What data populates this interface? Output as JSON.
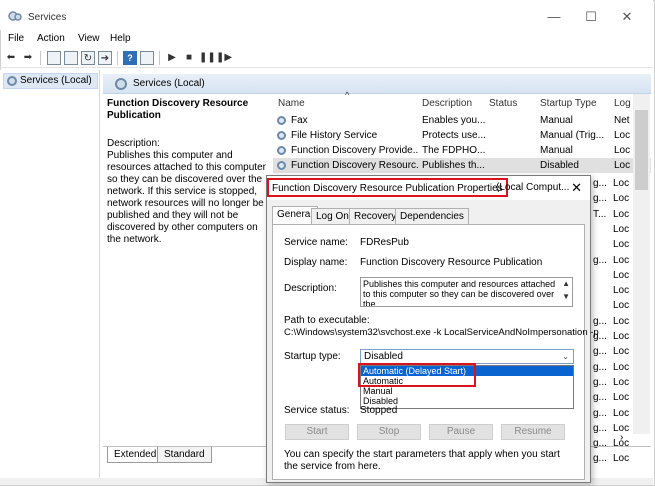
{
  "window": {
    "title": "Services",
    "controls": [
      "—",
      "☐",
      "✕"
    ]
  },
  "menu": [
    "File",
    "Action",
    "View",
    "Help"
  ],
  "tree": {
    "item": "Services (Local)"
  },
  "header": {
    "title": "Services (Local)"
  },
  "description": {
    "title": "Function Discovery Resource Publication",
    "label": "Description:",
    "body": "Publishes this computer and resources attached to this computer so they can be discovered over the network.  If this service is stopped, network resources will no longer be published and they will not be discovered by other computers on the network."
  },
  "list": {
    "columns": [
      "Name",
      "Description",
      "Status",
      "Startup Type",
      "Log"
    ],
    "rows": [
      {
        "name": "Fax",
        "description": "Enables you...",
        "status": "",
        "startup": "Manual",
        "log": "Net"
      },
      {
        "name": "File History Service",
        "description": "Protects use...",
        "status": "",
        "startup": "Manual (Trig...",
        "log": "Loc"
      },
      {
        "name": "Function Discovery Provide...",
        "description": "The FDPHO...",
        "status": "",
        "startup": "Manual",
        "log": "Loc"
      },
      {
        "name": "Function Discovery Resourc...",
        "description": "Publishes th...",
        "status": "",
        "startup": "Disabled",
        "log": "Loc"
      }
    ],
    "partial_log": [
      "Loc",
      "Loc",
      "Loc",
      "Loc",
      "Loc",
      "Loc",
      "Loc",
      "Loc",
      "Loc",
      "Loc",
      "Loc",
      "Loc",
      "Loc",
      "Loc",
      "Loc",
      "Loc",
      "Loc",
      "Loc",
      "Loc"
    ],
    "partial_startup": [
      "g...",
      "g...",
      "T...",
      "",
      "",
      "g...",
      "",
      "",
      "",
      "g...",
      "g...",
      "g...",
      "g...",
      "g...",
      "g...",
      "g...",
      "g...",
      "g...",
      "g..."
    ]
  },
  "bottom_tabs": [
    "Extended",
    "Standard"
  ],
  "dialog": {
    "title": "Function Discovery Resource Publication Properties",
    "title_suffix": "(Local Comput...",
    "tabs": [
      "General",
      "Log On",
      "Recovery",
      "Dependencies"
    ],
    "service_name_label": "Service name:",
    "service_name": "FDResPub",
    "display_name_label": "Display name:",
    "display_name": "Function Discovery Resource Publication",
    "description_label": "Description:",
    "description": "Publishes this computer and resources attached to this computer so they can be discovered over the",
    "path_label": "Path to executable:",
    "path": "C:\\Windows\\system32\\svchost.exe -k LocalServiceAndNoImpersonation -p",
    "startup_label": "Startup type:",
    "startup_value": "Disabled",
    "startup_options": [
      "Automatic (Delayed Start)",
      "Automatic",
      "Manual",
      "Disabled"
    ],
    "status_label": "Service status:",
    "status_value": "Stopped",
    "buttons": [
      "Start",
      "Stop",
      "Pause",
      "Resume"
    ],
    "note": "You can specify the start parameters that apply when you start the service from here."
  },
  "colors": {
    "highlight": "#0a64d0",
    "annotation": "#d9141b"
  }
}
